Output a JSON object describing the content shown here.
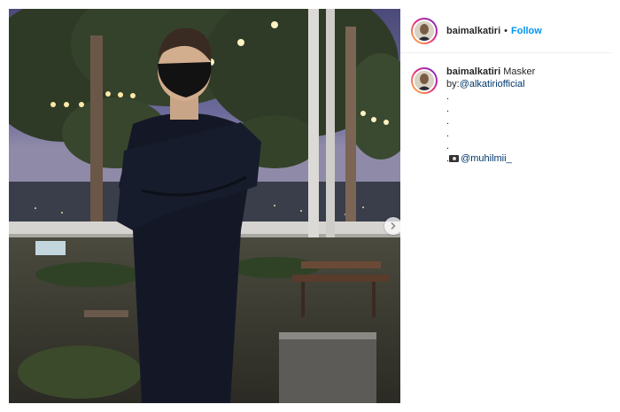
{
  "post": {
    "photo_alt": "night photo of a person in a black mask and sweater with crossed arms on a rooftop",
    "next_icon": "chevron-right-icon"
  },
  "header": {
    "username": "baimalkatiri",
    "separator": "•",
    "follow_label": "Follow"
  },
  "caption": {
    "username": "baimalkatiri",
    "text": "Masker",
    "by_prefix": "by:",
    "by_mention": "@alkatiriofficial",
    "dots": [
      ".",
      ".",
      ".",
      ".",
      "."
    ],
    "photo_prefix": ".",
    "photo_icon": "camera-icon",
    "photo_mention": "@muhilmii_"
  },
  "colors": {
    "accent": "#0095f6",
    "mention": "#00376b",
    "text": "#262626"
  }
}
